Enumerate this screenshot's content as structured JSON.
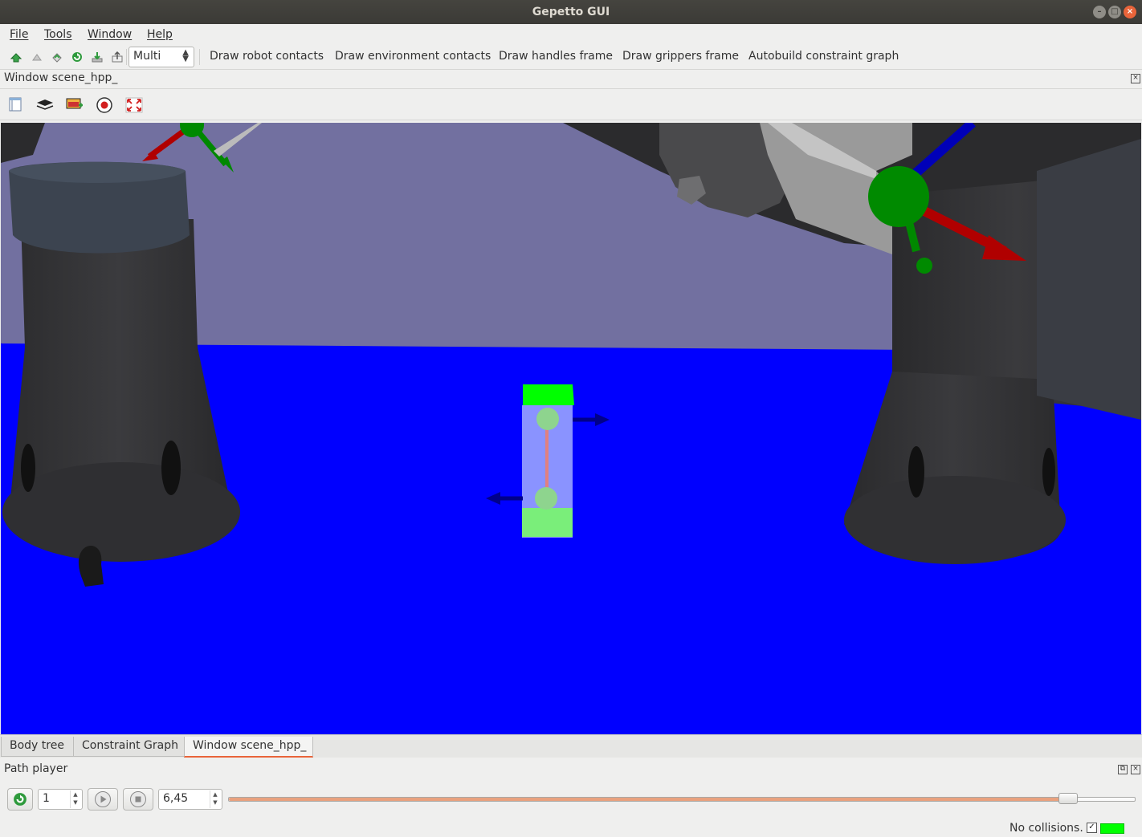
{
  "window": {
    "title": "Gepetto GUI"
  },
  "menu": [
    "File",
    "Tools",
    "Window",
    "Help"
  ],
  "toolbar": {
    "mode_value": "Multi",
    "actions": [
      "Draw robot contacts",
      "Draw environment contacts",
      "Draw handles frame",
      "Draw grippers frame",
      "Autobuild constraint graph"
    ]
  },
  "scene_dock": {
    "title": "Window scene_hpp_"
  },
  "tabs": [
    "Body tree",
    "Constraint Graph",
    "Window scene_hpp_"
  ],
  "active_tab": "Window scene_hpp_",
  "path_player": {
    "title": "Path player",
    "path_index": "1",
    "time_value": "6,45",
    "progress": 0.925
  },
  "status": {
    "collision_text": "No collisions.",
    "indicator_color": "#00ff00"
  },
  "scene_colors": {
    "floor": "#0000ff",
    "sky": "#7270a0",
    "box_top": "#00ff00"
  }
}
